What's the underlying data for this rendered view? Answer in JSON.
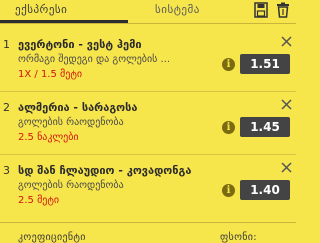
{
  "tabs": {
    "active": "ექსპრესი",
    "system": "სისტემა"
  },
  "bets": [
    {
      "number": "1",
      "teams": "ევერტონი - ვესტ ჰემი",
      "market": "ორმაგი შედეგი და გოლების ...",
      "pick": "1X / 1.5 მეტი",
      "odds": "1.51"
    },
    {
      "number": "2",
      "teams": "ალმერია - სარაგოსა",
      "market": "გოლების რაოდენობა",
      "pick": "2.5 ნაკლები",
      "odds": "1.45"
    },
    {
      "number": "3",
      "teams": "სდ შან ჩლაუდიო - კოვადონგა",
      "market": "გოლების რაოდენობა",
      "pick": "2.5 მეტი",
      "odds": "1.40"
    }
  ],
  "footer": {
    "coefficient_label": "კოეფიციენტი",
    "price_label": "ფსონი:"
  },
  "colors": {
    "background": "#f7e54c",
    "pick_red": "#d4160f",
    "odds_bg": "#444444"
  },
  "icons": [
    "save-icon",
    "trash-icon",
    "close-icon",
    "info-icon"
  ]
}
